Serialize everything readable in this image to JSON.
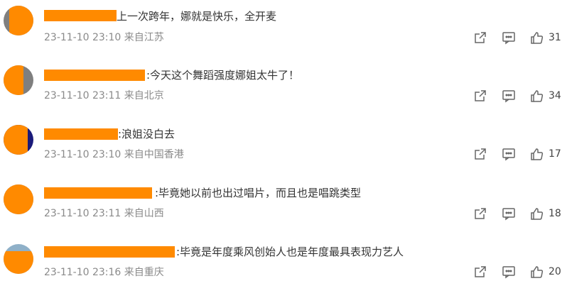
{
  "comments": [
    {
      "text": "上一次跨年，娜就是快乐，全开麦",
      "time": "23-11-10 23:10",
      "location": "来自江苏",
      "likes": "31"
    },
    {
      "text": ":今天这个舞蹈强度娜姐太牛了！",
      "time": "23-11-10 23:11",
      "location": "来自北京",
      "likes": "34"
    },
    {
      "text": ":浪姐没白去",
      "time": "23-11-10 23:10",
      "location": "来自中国香港",
      "likes": "17"
    },
    {
      "text": ":毕竟她以前也出过唱片，而且也是唱跳类型",
      "time": "23-11-10 23:11",
      "location": "来自山西",
      "likes": "18"
    },
    {
      "text": ":毕竟是年度乘风创始人也是年度最具表现力艺人",
      "time": "23-11-10 23:16",
      "location": "来自重庆",
      "likes": "20"
    }
  ],
  "icons": {
    "share": "share-icon",
    "comment": "comment-icon",
    "like": "like-icon"
  },
  "colors": {
    "redaction": "#ff8a00",
    "meta": "#8a8a8a",
    "text": "#333333"
  }
}
